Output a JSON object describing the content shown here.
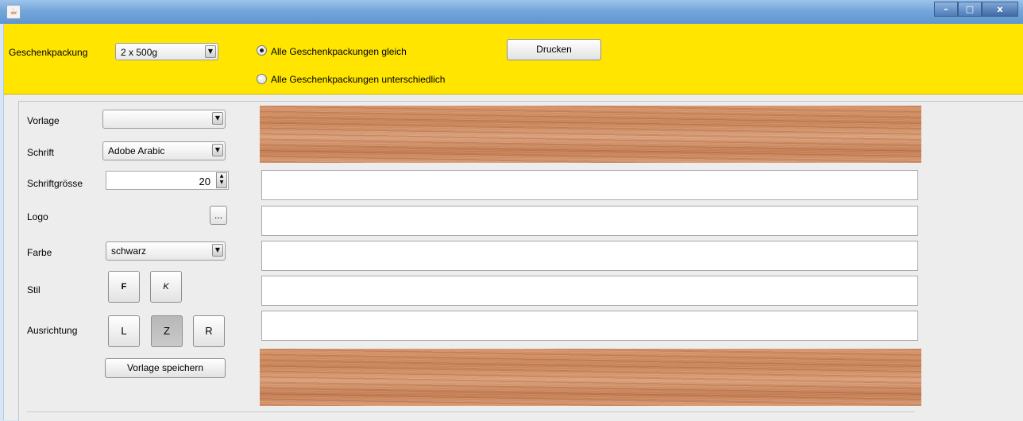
{
  "titlebar": {
    "icon": "java-cup-icon",
    "window_buttons": [
      "–",
      "□",
      "x"
    ]
  },
  "toolbar": {
    "packaging_label": "Geschenkpackung",
    "packaging_value": "2 x 500g",
    "radio_same_label": "Alle Geschenkpackungen gleich",
    "radio_different_label": "Alle Geschenkpackungen unterschiedlich",
    "radio_selected": "same",
    "print_label": "Drucken"
  },
  "form": {
    "template_label": "Vorlage",
    "template_value": "",
    "font_label": "Schrift",
    "font_value": "Adobe Arabic",
    "fontsize_label": "Schriftgrösse",
    "fontsize_value": "20",
    "logo_label": "Logo",
    "logo_button": "...",
    "color_label": "Farbe",
    "color_value": "schwarz",
    "style_label": "Stil",
    "bold_button": "F",
    "italic_button": "K",
    "alignment_label": "Ausrichtung",
    "align_left": "L",
    "align_center": "Z",
    "align_right": "R",
    "alignment_selected": "Z",
    "save_template_button": "Vorlage speichern"
  },
  "preview": {
    "text_lines": [
      "",
      "",
      "",
      "",
      ""
    ],
    "wood_color": "#cf8b5f"
  },
  "colors": {
    "toolbar_background": "#ffe500",
    "panel_background": "#ededed",
    "titlebar": "#75a6da"
  }
}
